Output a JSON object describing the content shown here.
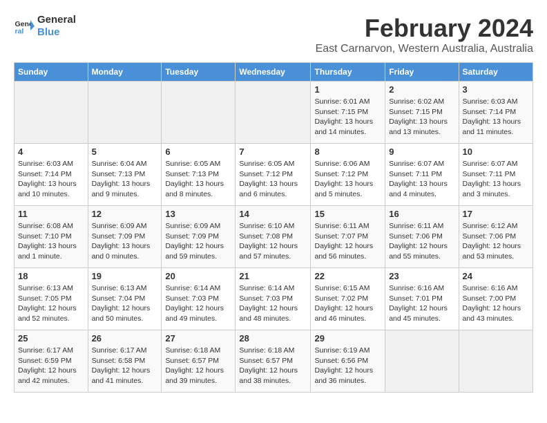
{
  "logo": {
    "line1": "General",
    "line2": "Blue"
  },
  "title": "February 2024",
  "subtitle": "East Carnarvon, Western Australia, Australia",
  "days_header": [
    "Sunday",
    "Monday",
    "Tuesday",
    "Wednesday",
    "Thursday",
    "Friday",
    "Saturday"
  ],
  "weeks": [
    [
      {
        "day": "",
        "info": ""
      },
      {
        "day": "",
        "info": ""
      },
      {
        "day": "",
        "info": ""
      },
      {
        "day": "",
        "info": ""
      },
      {
        "day": "1",
        "info": "Sunrise: 6:01 AM\nSunset: 7:15 PM\nDaylight: 13 hours\nand 14 minutes."
      },
      {
        "day": "2",
        "info": "Sunrise: 6:02 AM\nSunset: 7:15 PM\nDaylight: 13 hours\nand 13 minutes."
      },
      {
        "day": "3",
        "info": "Sunrise: 6:03 AM\nSunset: 7:14 PM\nDaylight: 13 hours\nand 11 minutes."
      }
    ],
    [
      {
        "day": "4",
        "info": "Sunrise: 6:03 AM\nSunset: 7:14 PM\nDaylight: 13 hours\nand 10 minutes."
      },
      {
        "day": "5",
        "info": "Sunrise: 6:04 AM\nSunset: 7:13 PM\nDaylight: 13 hours\nand 9 minutes."
      },
      {
        "day": "6",
        "info": "Sunrise: 6:05 AM\nSunset: 7:13 PM\nDaylight: 13 hours\nand 8 minutes."
      },
      {
        "day": "7",
        "info": "Sunrise: 6:05 AM\nSunset: 7:12 PM\nDaylight: 13 hours\nand 6 minutes."
      },
      {
        "day": "8",
        "info": "Sunrise: 6:06 AM\nSunset: 7:12 PM\nDaylight: 13 hours\nand 5 minutes."
      },
      {
        "day": "9",
        "info": "Sunrise: 6:07 AM\nSunset: 7:11 PM\nDaylight: 13 hours\nand 4 minutes."
      },
      {
        "day": "10",
        "info": "Sunrise: 6:07 AM\nSunset: 7:11 PM\nDaylight: 13 hours\nand 3 minutes."
      }
    ],
    [
      {
        "day": "11",
        "info": "Sunrise: 6:08 AM\nSunset: 7:10 PM\nDaylight: 13 hours\nand 1 minute."
      },
      {
        "day": "12",
        "info": "Sunrise: 6:09 AM\nSunset: 7:09 PM\nDaylight: 13 hours\nand 0 minutes."
      },
      {
        "day": "13",
        "info": "Sunrise: 6:09 AM\nSunset: 7:09 PM\nDaylight: 12 hours\nand 59 minutes."
      },
      {
        "day": "14",
        "info": "Sunrise: 6:10 AM\nSunset: 7:08 PM\nDaylight: 12 hours\nand 57 minutes."
      },
      {
        "day": "15",
        "info": "Sunrise: 6:11 AM\nSunset: 7:07 PM\nDaylight: 12 hours\nand 56 minutes."
      },
      {
        "day": "16",
        "info": "Sunrise: 6:11 AM\nSunset: 7:06 PM\nDaylight: 12 hours\nand 55 minutes."
      },
      {
        "day": "17",
        "info": "Sunrise: 6:12 AM\nSunset: 7:06 PM\nDaylight: 12 hours\nand 53 minutes."
      }
    ],
    [
      {
        "day": "18",
        "info": "Sunrise: 6:13 AM\nSunset: 7:05 PM\nDaylight: 12 hours\nand 52 minutes."
      },
      {
        "day": "19",
        "info": "Sunrise: 6:13 AM\nSunset: 7:04 PM\nDaylight: 12 hours\nand 50 minutes."
      },
      {
        "day": "20",
        "info": "Sunrise: 6:14 AM\nSunset: 7:03 PM\nDaylight: 12 hours\nand 49 minutes."
      },
      {
        "day": "21",
        "info": "Sunrise: 6:14 AM\nSunset: 7:03 PM\nDaylight: 12 hours\nand 48 minutes."
      },
      {
        "day": "22",
        "info": "Sunrise: 6:15 AM\nSunset: 7:02 PM\nDaylight: 12 hours\nand 46 minutes."
      },
      {
        "day": "23",
        "info": "Sunrise: 6:16 AM\nSunset: 7:01 PM\nDaylight: 12 hours\nand 45 minutes."
      },
      {
        "day": "24",
        "info": "Sunrise: 6:16 AM\nSunset: 7:00 PM\nDaylight: 12 hours\nand 43 minutes."
      }
    ],
    [
      {
        "day": "25",
        "info": "Sunrise: 6:17 AM\nSunset: 6:59 PM\nDaylight: 12 hours\nand 42 minutes."
      },
      {
        "day": "26",
        "info": "Sunrise: 6:17 AM\nSunset: 6:58 PM\nDaylight: 12 hours\nand 41 minutes."
      },
      {
        "day": "27",
        "info": "Sunrise: 6:18 AM\nSunset: 6:57 PM\nDaylight: 12 hours\nand 39 minutes."
      },
      {
        "day": "28",
        "info": "Sunrise: 6:18 AM\nSunset: 6:57 PM\nDaylight: 12 hours\nand 38 minutes."
      },
      {
        "day": "29",
        "info": "Sunrise: 6:19 AM\nSunset: 6:56 PM\nDaylight: 12 hours\nand 36 minutes."
      },
      {
        "day": "",
        "info": ""
      },
      {
        "day": "",
        "info": ""
      }
    ]
  ]
}
